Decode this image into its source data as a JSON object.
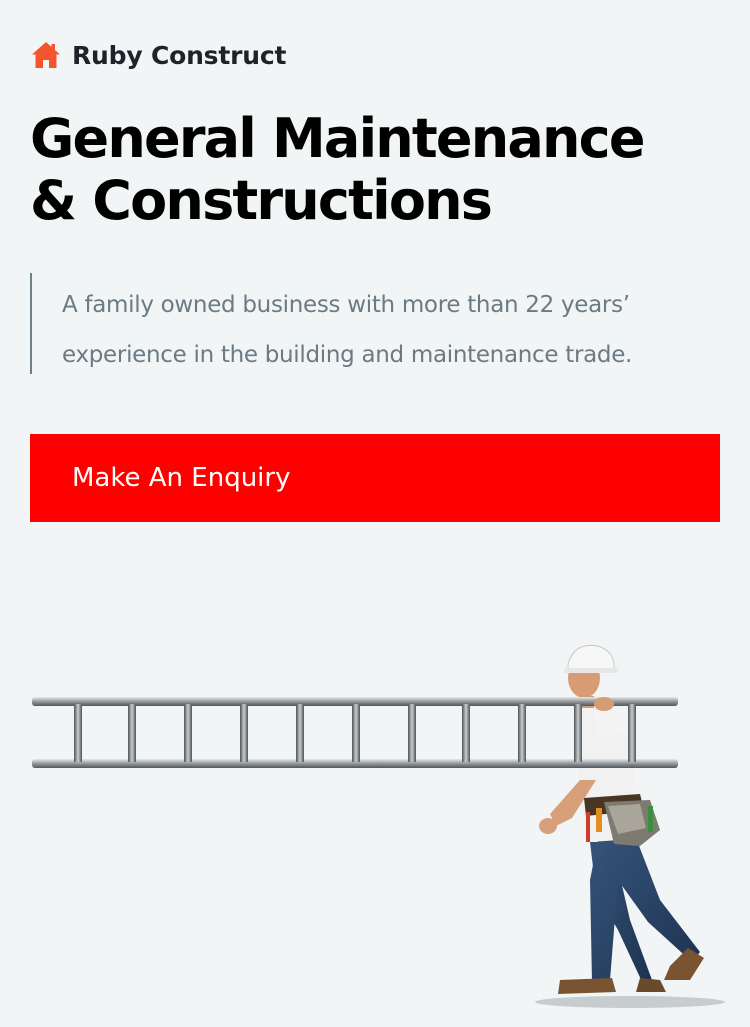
{
  "header": {
    "brand_icon": "home-icon",
    "brand_name": "Ruby Construct",
    "brand_color": "#f4552f"
  },
  "hero": {
    "headline_line1": "General Maintenance",
    "headline_line2": "& Constructions",
    "tagline_line1": "A family owned business with more than 22 years’",
    "tagline_line2": "experience in the building and maintenance trade.",
    "cta_label": "Make An Enquiry",
    "cta_color": "#ff0000",
    "illustration": "worker-carrying-ladder-image"
  }
}
